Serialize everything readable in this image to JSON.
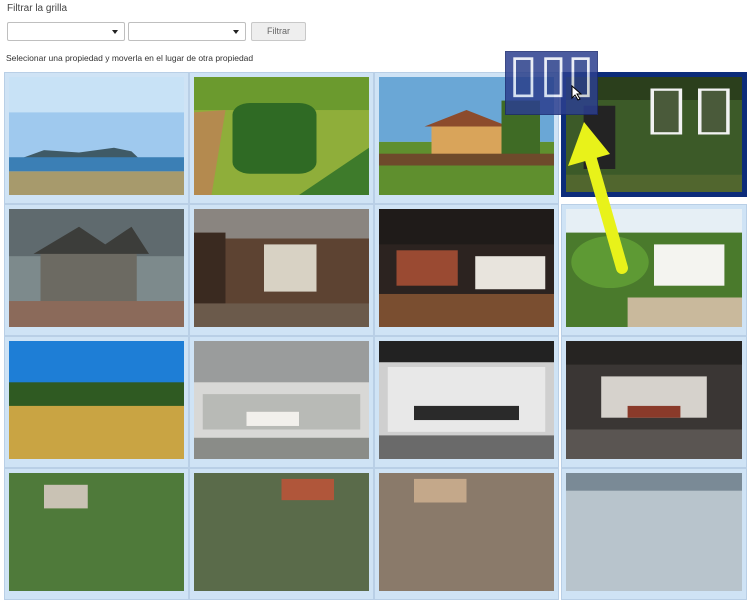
{
  "filter": {
    "title": "Filtrar la grilla",
    "select1_value": "",
    "select2_value": "",
    "button_label": "Filtrar"
  },
  "instruction": "Selecionar una propiedad y moverla en el lugar de otra propiedad",
  "grid": {
    "selected_index": 3,
    "items": [
      {
        "icon": "coastline-photo-icon"
      },
      {
        "icon": "aerial-trees-photo-icon"
      },
      {
        "icon": "villa-palm-photo-icon"
      },
      {
        "icon": "ivy-house-photo-icon"
      },
      {
        "icon": "stone-mansion-photo-icon"
      },
      {
        "icon": "industrial-interior-photo-icon"
      },
      {
        "icon": "loft-office-photo-icon"
      },
      {
        "icon": "cottage-garden-photo-icon"
      },
      {
        "icon": "wheat-field-photo-icon"
      },
      {
        "icon": "open-office-photo-icon"
      },
      {
        "icon": "glass-meeting-room-photo-icon"
      },
      {
        "icon": "modern-office-photo-icon"
      },
      {
        "icon": "aerial-town-photo-icon"
      },
      {
        "icon": "aerial-roofs-photo-icon"
      },
      {
        "icon": "aerial-street-photo-icon"
      },
      {
        "icon": "building-top-photo-icon"
      }
    ]
  },
  "colors": {
    "selected_border": "#0c2c7a",
    "cell_background": "#cfe3f5",
    "annotation_arrow": "#e8f21a"
  }
}
